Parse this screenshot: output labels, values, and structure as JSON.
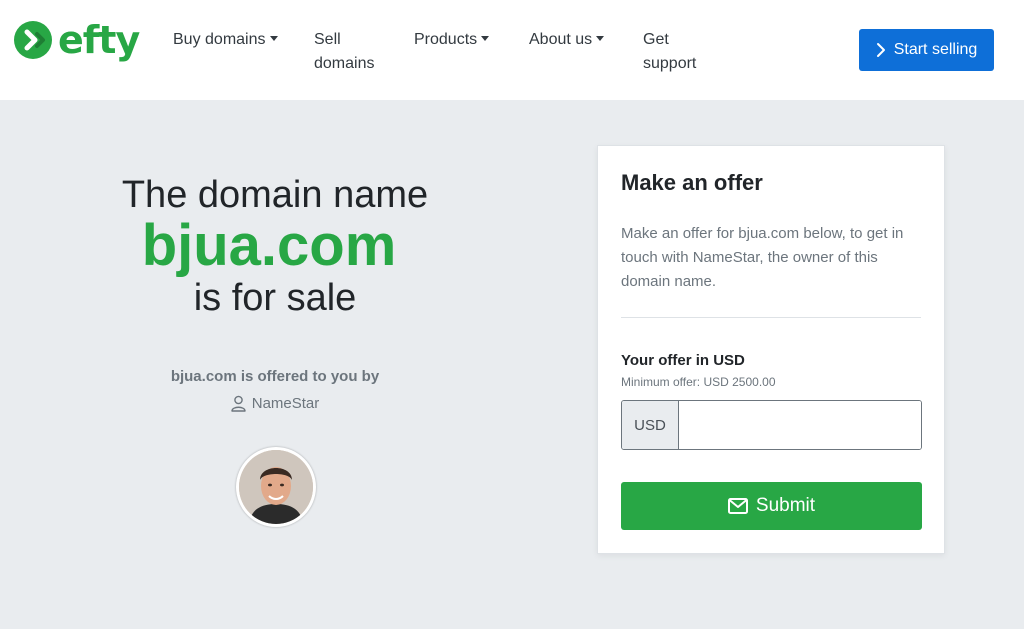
{
  "brand": {
    "name": "efty",
    "color": "#28a745"
  },
  "nav": {
    "items": [
      {
        "label": "Buy domains",
        "dropdown": true
      },
      {
        "label": "Sell domains",
        "dropdown": false
      },
      {
        "label": "Products",
        "dropdown": true
      },
      {
        "label": "About us",
        "dropdown": true
      },
      {
        "label": "Get support",
        "dropdown": false
      }
    ],
    "cta_label": "Start selling",
    "cta_icon": "chevron-right-icon",
    "cta_color": "#0e6fd8"
  },
  "hero": {
    "line1": "The domain name",
    "domain": "bjua.com",
    "line3": "is for sale",
    "offered_by": "bjua.com is offered to you by",
    "owner_icon": "user-icon",
    "owner_name": "NameStar"
  },
  "offer": {
    "title": "Make an offer",
    "description": "Make an offer for bjua.com below, to get in touch with NameStar, the owner of this domain name.",
    "field_label": "Your offer in USD",
    "minimum": "Minimum offer: USD 2500.00",
    "currency": "USD",
    "value": "",
    "submit_label": "Submit",
    "submit_icon": "envelope-icon"
  }
}
